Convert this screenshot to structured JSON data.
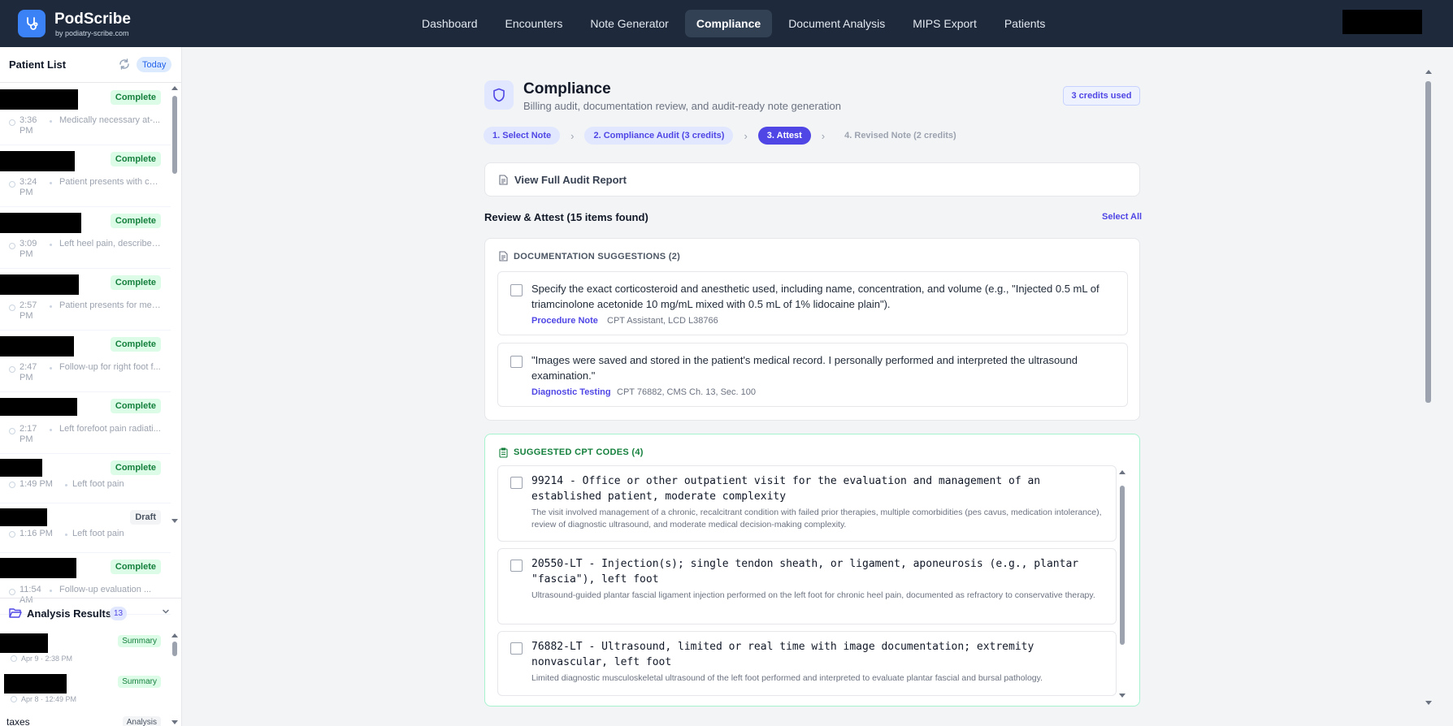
{
  "app": {
    "name": "PodScribe",
    "subtitle": "by podiatry-scribe.com",
    "colors": {
      "nav_bg": "#1e293b",
      "accent": "#4f46e5",
      "success": "#15803d",
      "brand": "#3b82f6"
    }
  },
  "nav": {
    "items": [
      "Dashboard",
      "Encounters",
      "Note Generator",
      "Compliance",
      "Document Analysis",
      "MIPS Export",
      "Patients"
    ],
    "active": "Compliance"
  },
  "sidebar": {
    "patient_list": {
      "title": "Patient List",
      "filter": "Today",
      "items": [
        {
          "status": "Complete",
          "time": "3:36 PM",
          "summary": "Medically necessary at-..."
        },
        {
          "status": "Complete",
          "time": "3:24 PM",
          "summary": "Patient presents with con..."
        },
        {
          "status": "Complete",
          "time": "3:09 PM",
          "summary": "Left heel pain, described ..."
        },
        {
          "status": "Complete",
          "time": "2:57 PM",
          "summary": "Patient presents for medi..."
        },
        {
          "status": "Complete",
          "time": "2:47 PM",
          "summary": "Follow-up for right foot f..."
        },
        {
          "status": "Complete",
          "time": "2:17 PM",
          "summary": "Left forefoot pain radiati..."
        },
        {
          "status": "Complete",
          "time": "1:49 PM",
          "summary": "Left foot pain"
        },
        {
          "status": "Draft",
          "time": "1:16 PM",
          "summary": "Left foot pain"
        },
        {
          "status": "Complete",
          "time": "11:54 AM",
          "summary": "Follow-up evaluation ..."
        }
      ]
    },
    "analysis_results": {
      "title": "Analysis Results",
      "count": "13",
      "items": [
        {
          "type": "Summary",
          "date": "Apr 9 · 2:38 PM",
          "name": ""
        },
        {
          "type": "Summary",
          "date": "Apr 8 · 12:49 PM",
          "name": ""
        },
        {
          "type": "Analysis",
          "date": "",
          "name": "taxes"
        }
      ]
    }
  },
  "page": {
    "title": "Compliance",
    "subtitle": "Billing audit, documentation review, and audit-ready note generation",
    "credits": "3 credits used",
    "steps": [
      {
        "label": "1. Select Note",
        "state": "done"
      },
      {
        "label": "2. Compliance Audit (3 credits)",
        "state": "done"
      },
      {
        "label": "3. Attest",
        "state": "active"
      },
      {
        "label": "4. Revised Note (2 credits)",
        "state": "future"
      }
    ],
    "audit_report": "View Full Audit Report",
    "review_title": "Review & Attest (15 items found)",
    "select_all": "Select All"
  },
  "documentation": {
    "heading": "DOCUMENTATION SUGGESTIONS (2)",
    "items": [
      {
        "text": "Specify the exact corticosteroid and anesthetic used, including name, concentration, and volume (e.g., \"Injected 0.5 mL of triamcinolone acetonide 10 mg/mL mixed with 0.5 mL of 1% lidocaine plain\").",
        "category": "Procedure Note",
        "reference": "CPT Assistant, LCD L38766"
      },
      {
        "text": "\"Images were saved and stored in the patient's medical record. I personally performed and interpreted the ultrasound examination.\"",
        "category": "Diagnostic Testing",
        "reference": "CPT 76882, CMS Ch. 13, Sec. 100"
      }
    ]
  },
  "cpt": {
    "heading": "SUGGESTED CPT CODES (4)",
    "items": [
      {
        "code": "99214 - Office or other outpatient visit for the evaluation and management of an established patient, moderate complexity",
        "rationale": "The visit involved management of a chronic, recalcitrant condition with failed prior therapies, multiple comorbidities (pes cavus, medication intolerance), review of diagnostic ultrasound, and moderate medical decision-making complexity."
      },
      {
        "code": "20550-LT - Injection(s); single tendon sheath, or ligament, aponeurosis (e.g., plantar \"fascia\"), left foot",
        "rationale": "Ultrasound-guided plantar fascial ligament injection performed on the left foot for chronic heel pain, documented as refractory to conservative therapy."
      },
      {
        "code": "76882-LT - Ultrasound, limited or real time with image documentation; extremity nonvascular, left foot",
        "rationale": "Limited diagnostic musculoskeletal ultrasound of the left foot performed and interpreted to evaluate plantar fascial and bursal pathology."
      }
    ]
  }
}
